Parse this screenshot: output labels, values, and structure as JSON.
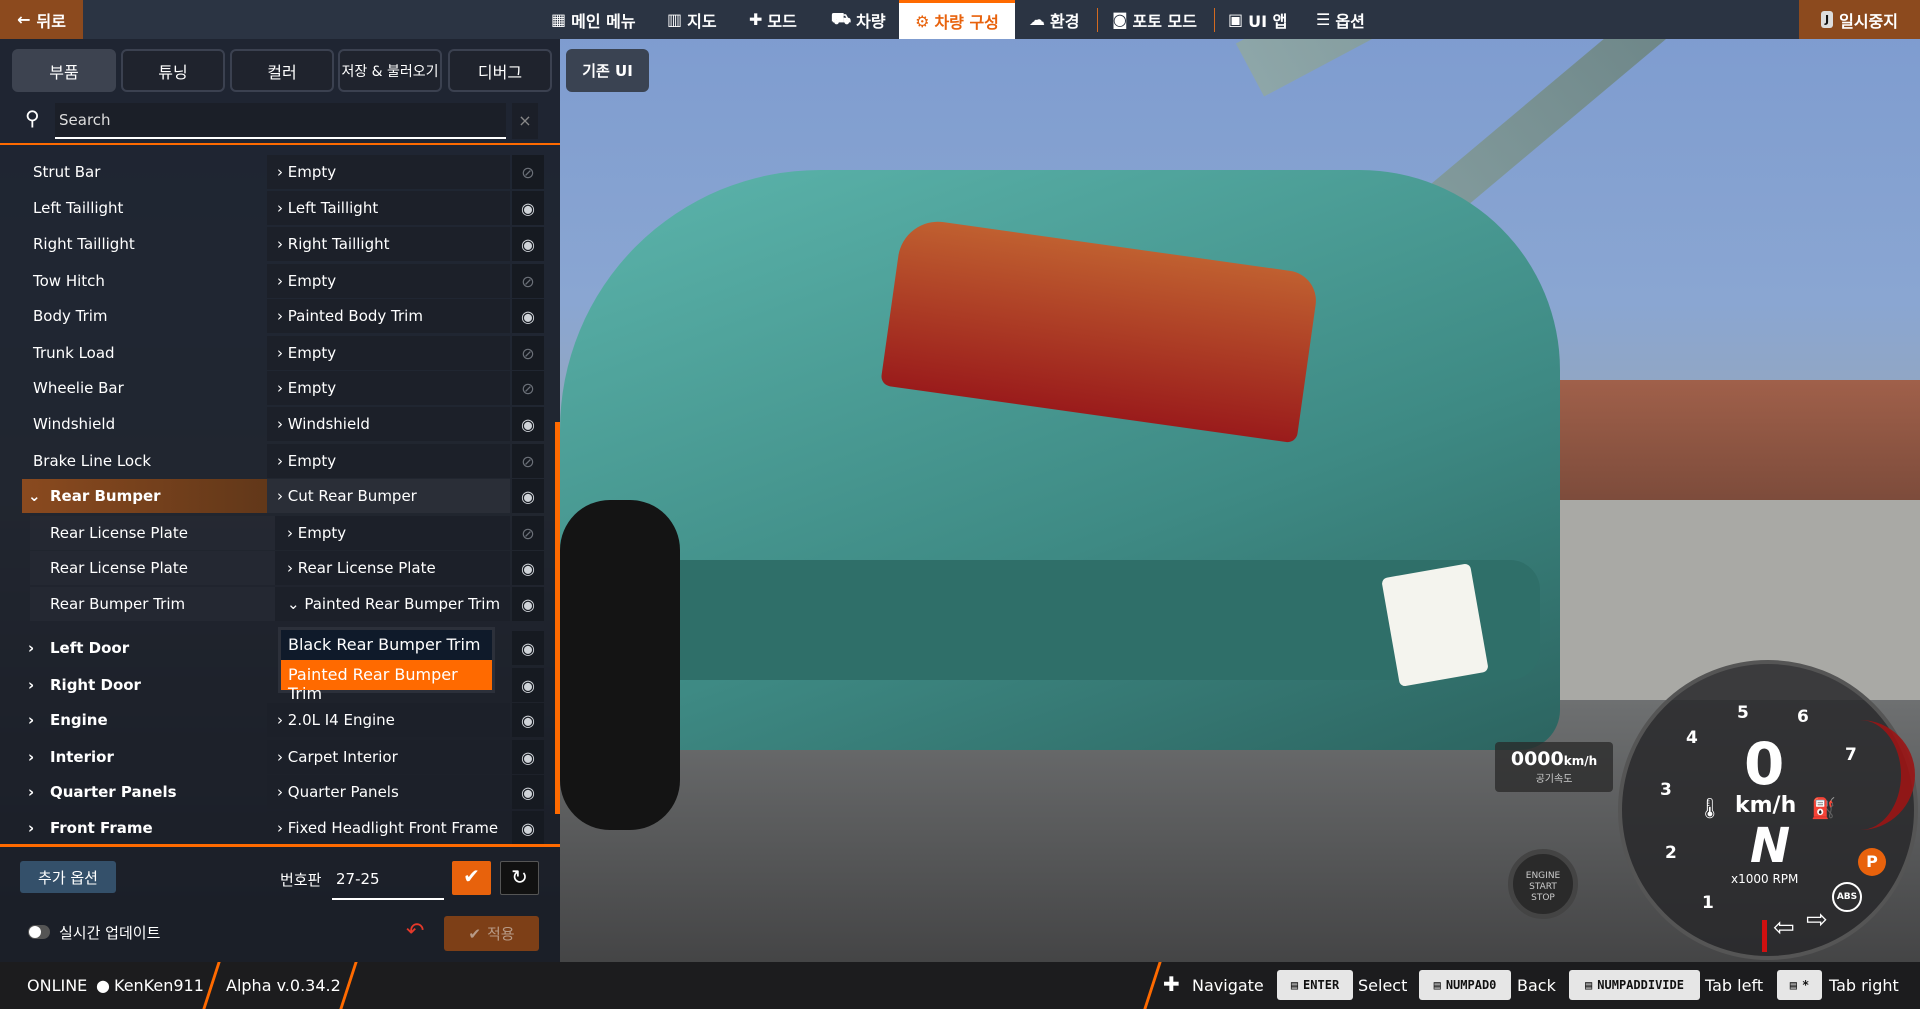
{
  "topbar": {
    "back": "뒤로",
    "nav": [
      "메인 메뉴",
      "지도",
      "모드",
      "차량",
      "차량 구성",
      "환경",
      "포토 모드",
      "UI 앱",
      "옵션"
    ],
    "active": "차량 구성",
    "pause": "일시중지",
    "pause_key": "J"
  },
  "tabs": [
    "부품",
    "튜닝",
    "컬러",
    "저장 & 불러오기",
    "디버그"
  ],
  "active_tab": "부품",
  "legacy_ui": "기존 UI",
  "search": {
    "placeholder": "Search",
    "clear": "×"
  },
  "parts": [
    {
      "name": "Strut Bar",
      "value": "Empty",
      "visible": false
    },
    {
      "name": "Left Taillight",
      "value": "Left Taillight",
      "visible": true
    },
    {
      "name": "Right Taillight",
      "value": "Right Taillight",
      "visible": true
    },
    {
      "name": "Tow Hitch",
      "value": "Empty",
      "visible": false
    },
    {
      "name": "Body Trim",
      "value": "Painted Body Trim",
      "visible": true
    },
    {
      "name": "Trunk Load",
      "value": "Empty",
      "visible": false
    },
    {
      "name": "Wheelie Bar",
      "value": "Empty",
      "visible": false
    },
    {
      "name": "Windshield",
      "value": "Windshield",
      "visible": true
    },
    {
      "name": "Brake Line Lock",
      "value": "Empty",
      "visible": false
    },
    {
      "name": "Rear Bumper",
      "value": "Cut Rear Bumper",
      "visible": true
    },
    {
      "name": "Rear License Plate",
      "value": "Empty",
      "visible": false
    },
    {
      "name": "Rear License Plate",
      "value": "Rear License Plate",
      "visible": true
    },
    {
      "name": "Rear Bumper Trim",
      "value": "Painted Rear Bumper Trim",
      "visible": true
    },
    {
      "name": "Left Door",
      "value": "",
      "visible": true
    },
    {
      "name": "Right Door",
      "value": "",
      "visible": true
    },
    {
      "name": "Engine",
      "value": "2.0L I4 Engine",
      "visible": true
    },
    {
      "name": "Interior",
      "value": "Carpet Interior",
      "visible": true
    },
    {
      "name": "Quarter Panels",
      "value": "Quarter Panels",
      "visible": true
    },
    {
      "name": "Front Frame",
      "value": "Fixed Headlight Front Frame",
      "visible": true
    }
  ],
  "dropdown": {
    "options": [
      "Black Rear Bumper Trim",
      "Painted Rear Bumper Trim"
    ],
    "selected": "Painted Rear Bumper Trim"
  },
  "bottom": {
    "extra_options": "추가 옵션",
    "plate_label": "번호판",
    "plate_value": "27-25",
    "live_update": "실시간 업데이트",
    "live_update_on": false,
    "apply": "적용"
  },
  "status": {
    "online": "ONLINE",
    "user": "KenKen911",
    "version": "Alpha v.0.34.2",
    "hints": [
      {
        "label": "Navigate"
      },
      {
        "key": "ENTER",
        "label": "Select"
      },
      {
        "key": "NUMPAD0",
        "label": "Back"
      },
      {
        "key": "NUMPADDIVIDE",
        "label": "Tab left"
      },
      {
        "key": "*",
        "label": "Tab right"
      }
    ]
  },
  "hud": {
    "airspeed": "0000",
    "airspeed_unit": "km/h",
    "airspeed_label": "공기속도",
    "speed": "0",
    "speed_unit": "km/h",
    "gear": "N",
    "rpm_label": "x1000 RPM",
    "rpm_ticks": [
      "1",
      "2",
      "3",
      "4",
      "5",
      "6",
      "7"
    ],
    "engine": [
      "ENGINE",
      "START",
      "STOP"
    ],
    "parking": "P",
    "abs": "ABS"
  },
  "colors": {
    "accent": "#ff6a00",
    "panel": "#181c26",
    "topbar": "#2b3443"
  }
}
